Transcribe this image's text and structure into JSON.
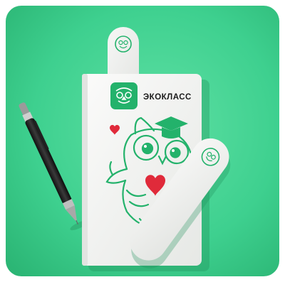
{
  "brand": {
    "name": "ЭКОКЛАСС",
    "logo_icon": "owl-logo-icon",
    "accent_color": "#23b26b"
  },
  "scene": {
    "background_color": "#3ed08f",
    "book_color": "#f4f5f3",
    "illustration_color": "#23b26b",
    "heart_color": "#e02a3a"
  }
}
